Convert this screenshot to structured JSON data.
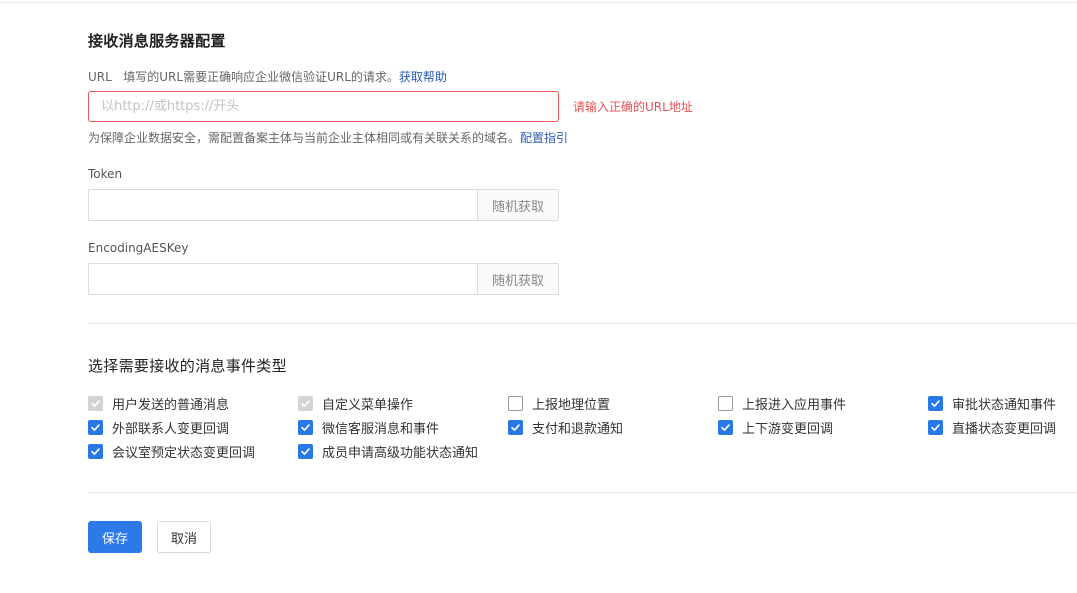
{
  "server_config": {
    "title": "接收消息服务器配置",
    "url_label": "URL",
    "url_hint": "填写的URL需要正确响应企业微信验证URL的请求。",
    "url_help_link": "获取帮助",
    "url_placeholder": "以http://或https://开头",
    "url_value": "",
    "url_error": "请输入正确的URL地址",
    "security_hint": "为保障企业数据安全，需配置备案主体与当前企业主体相同或有关联关系的域名。",
    "security_link": "配置指引",
    "token_label": "Token",
    "token_value": "",
    "token_button": "随机获取",
    "aes_label": "EncodingAESKey",
    "aes_value": "",
    "aes_button": "随机获取"
  },
  "events": {
    "title": "选择需要接收的消息事件类型",
    "items": [
      {
        "label": "用户发送的普通消息",
        "state": "disabled"
      },
      {
        "label": "自定义菜单操作",
        "state": "disabled"
      },
      {
        "label": "上报地理位置",
        "state": "unchecked"
      },
      {
        "label": "上报进入应用事件",
        "state": "unchecked"
      },
      {
        "label": "审批状态通知事件",
        "state": "checked"
      },
      {
        "label": "外部联系人变更回调",
        "state": "checked"
      },
      {
        "label": "微信客服消息和事件",
        "state": "checked"
      },
      {
        "label": "支付和退款通知",
        "state": "checked"
      },
      {
        "label": "上下游变更回调",
        "state": "checked"
      },
      {
        "label": "直播状态变更回调",
        "state": "checked"
      },
      {
        "label": "会议室预定状态变更回调",
        "state": "checked"
      },
      {
        "label": "成员申请高级功能状态通知",
        "state": "checked"
      }
    ]
  },
  "actions": {
    "save_label": "保存",
    "cancel_label": "取消"
  },
  "colors": {
    "accent": "#2c7ae8",
    "error": "#e65252",
    "link": "#2a5bb5"
  }
}
